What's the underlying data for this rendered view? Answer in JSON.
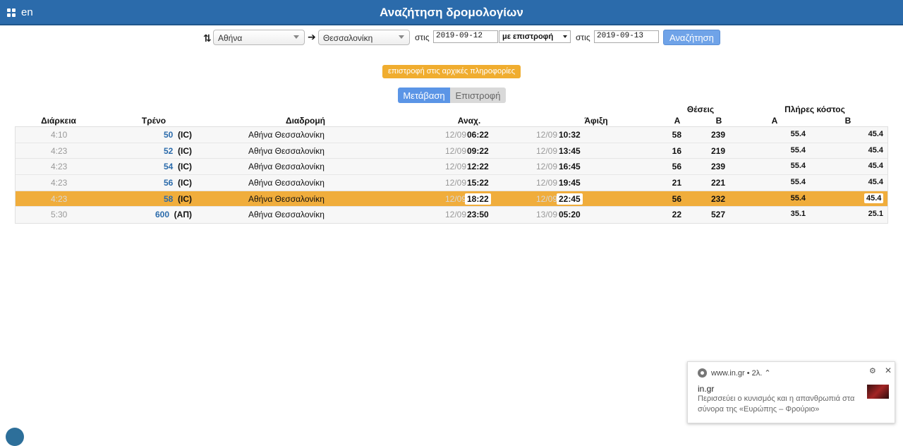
{
  "header": {
    "lang": "en",
    "title": "Αναζήτηση δρομολογίων"
  },
  "search": {
    "from": "Αθήνα",
    "to": "Θεσσαλονίκη",
    "on_label_1": "στις",
    "date_out": "2019-09-12",
    "return_type": "με επιστροφή",
    "on_label_2": "στις",
    "date_ret": "2019-09-13",
    "search_label": "Αναζήτηση"
  },
  "back_label": "επιστροφή στις αρχικές πληροφορίες",
  "tabs": {
    "outbound": "Μετάβαση",
    "return": "Επιστροφή"
  },
  "columns": {
    "duration": "Διάρκεια",
    "train": "Τρένο",
    "route": "Διαδρομή",
    "departure": "Αναχ.",
    "arrival": "Άφιξη",
    "seats": "Θέσεις",
    "seats_a": "Α",
    "seats_b": "Β",
    "cost": "Πλήρες κόστος",
    "cost_a": "Α",
    "cost_b": "Β"
  },
  "rows": [
    {
      "duration": "4:10",
      "train_no": "50",
      "train_type": "(IC)",
      "route": "Αθήνα  Θεσσαλονίκη",
      "dep_date": "12/09",
      "dep_time": "06:22",
      "arr_date": "12/09",
      "arr_time": "10:32",
      "seats_a": "58",
      "seats_b": "239",
      "cost_a": "55.4",
      "cost_b": "45.4"
    },
    {
      "duration": "4:23",
      "train_no": "52",
      "train_type": "(IC)",
      "route": "Αθήνα  Θεσσαλονίκη",
      "dep_date": "12/09",
      "dep_time": "09:22",
      "arr_date": "12/09",
      "arr_time": "13:45",
      "seats_a": "16",
      "seats_b": "219",
      "cost_a": "55.4",
      "cost_b": "45.4"
    },
    {
      "duration": "4:23",
      "train_no": "54",
      "train_type": "(IC)",
      "route": "Αθήνα  Θεσσαλονίκη",
      "dep_date": "12/09",
      "dep_time": "12:22",
      "arr_date": "12/09",
      "arr_time": "16:45",
      "seats_a": "56",
      "seats_b": "239",
      "cost_a": "55.4",
      "cost_b": "45.4"
    },
    {
      "duration": "4:23",
      "train_no": "56",
      "train_type": "(IC)",
      "route": "Αθήνα  Θεσσαλονίκη",
      "dep_date": "12/09",
      "dep_time": "15:22",
      "arr_date": "12/09",
      "arr_time": "19:45",
      "seats_a": "21",
      "seats_b": "221",
      "cost_a": "55.4",
      "cost_b": "45.4"
    },
    {
      "duration": "4:23",
      "train_no": "58",
      "train_type": "(IC)",
      "route": "Αθήνα  Θεσσαλονίκη",
      "dep_date": "12/09",
      "dep_time": "18:22",
      "arr_date": "12/09",
      "arr_time": "22:45",
      "seats_a": "56",
      "seats_b": "232",
      "cost_a": "55.4",
      "cost_b": "45.4"
    },
    {
      "duration": "5:30",
      "train_no": "600",
      "train_type": "(ΑΠ)",
      "route": "Αθήνα  Θεσσαλονίκη",
      "dep_date": "12/09",
      "dep_time": "23:50",
      "arr_date": "13/09",
      "arr_time": "05:20",
      "seats_a": "22",
      "seats_b": "527",
      "cost_a": "35.1",
      "cost_b": "25.1"
    }
  ],
  "notification": {
    "source": "www.in.gr • 2λ. ⌃",
    "title": "in.gr",
    "body": "Περισσεύει ο κυνισμός και η απανθρωπιά στα σύνορα της «Ευρώπης – Φρούριο»"
  },
  "colors": {
    "header": "#2b6bab",
    "accent": "#f0ad2f",
    "tab_active": "#5b95e6",
    "train_link": "#2b6bab"
  }
}
